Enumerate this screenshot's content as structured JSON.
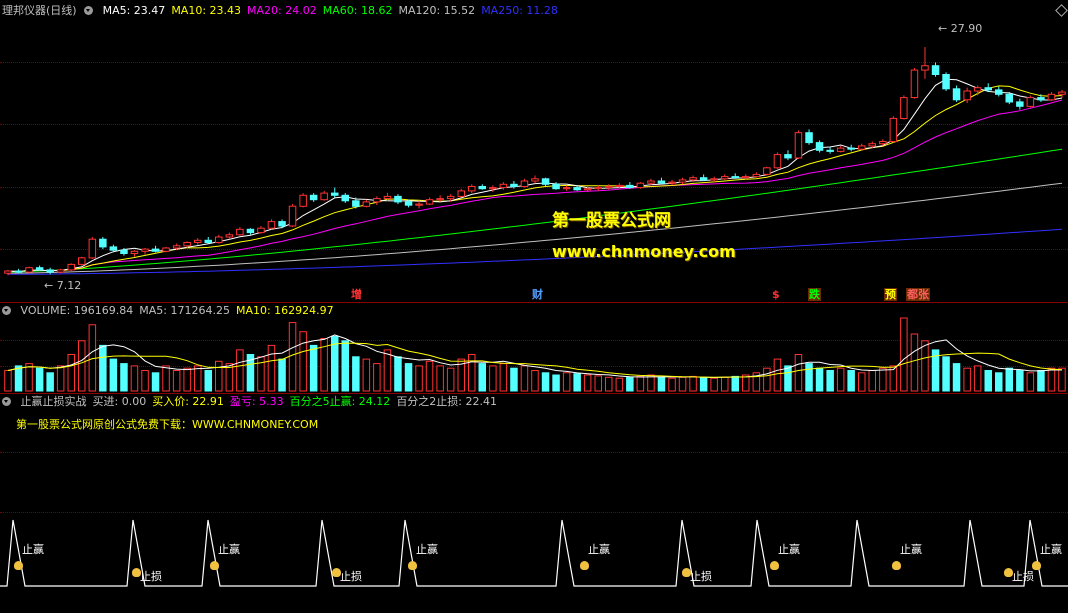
{
  "colors": {
    "up": "#ff3232",
    "down": "#54ffff",
    "ma5": "#ffffff",
    "ma10": "#ffff00",
    "ma20": "#ff00ff",
    "ma60": "#00ff00",
    "ma120": "#c0c0c0",
    "ma250": "#3030ff",
    "grid": "#7a0000"
  },
  "main_panel": {
    "title": "理邦仪器(日线)",
    "indicators": [
      {
        "label": "MA5: 23.47",
        "color": "#ffffff"
      },
      {
        "label": "MA10: 23.43",
        "color": "#ffff00"
      },
      {
        "label": "MA20: 24.02",
        "color": "#ff00ff"
      },
      {
        "label": "MA60: 18.62",
        "color": "#00ff00"
      },
      {
        "label": "MA120: 15.52",
        "color": "#c0c0c0"
      },
      {
        "label": "MA250: 11.28",
        "color": "#3030ff"
      }
    ],
    "high_label": "27.90",
    "low_label": "7.12",
    "event_tags": [
      {
        "text": "增",
        "color": "#ff3232",
        "bg": "#000000"
      },
      {
        "text": "财",
        "color": "#54a0ff",
        "bg": "#000000"
      },
      {
        "text": "$",
        "color": "#ff3232",
        "bg": "#000000"
      },
      {
        "text": "跌",
        "color": "#00ff00",
        "bg": "#6b2a00"
      },
      {
        "text": "预",
        "color": "#ffff00",
        "bg": "#6b2a00"
      },
      {
        "text": "都张",
        "color": "#ff6060",
        "bg": "#6b2a00"
      }
    ],
    "watermark_line1": "第一股票公式网",
    "watermark_line2": "www.chnmoney.com"
  },
  "volume_panel": {
    "indicators": [
      {
        "label": "VOLUME: 196169.84",
        "color": "#c0c0c0"
      },
      {
        "label": "MA5: 171264.25",
        "color": "#c0c0c0"
      },
      {
        "label": "MA10: 162924.97",
        "color": "#ffff00"
      }
    ]
  },
  "signal_panel": {
    "indicators": [
      {
        "label": "止赢止损实战",
        "color": "#c0c0c0"
      },
      {
        "label": "买进: 0.00",
        "color": "#c0c0c0"
      },
      {
        "label": "买入价: 22.91",
        "color": "#ffff00"
      },
      {
        "label": "盈亏: 5.33",
        "color": "#ff00ff"
      },
      {
        "label": "百分之5止赢: 24.12",
        "color": "#00ff00"
      },
      {
        "label": "百分之2止损: 22.41",
        "color": "#c0c0c0"
      }
    ],
    "promo": "第一股票公式网原创公式免费下载：WWW.CHNMONEY.COM",
    "take_profit_label": "止赢",
    "stop_loss_label": "止损"
  },
  "chart_data": {
    "type": "candlestick",
    "price_range": [
      7.12,
      27.9
    ],
    "price_axis_visible": [
      6.5,
      30.0
    ],
    "candles": [
      [
        7.3,
        7.6,
        7.1,
        7.5
      ],
      [
        7.5,
        7.7,
        7.3,
        7.4
      ],
      [
        7.4,
        7.9,
        7.3,
        7.8
      ],
      [
        7.8,
        8.0,
        7.5,
        7.6
      ],
      [
        7.6,
        7.8,
        7.2,
        7.4
      ],
      [
        7.4,
        7.7,
        7.3,
        7.6
      ],
      [
        7.6,
        8.2,
        7.5,
        8.1
      ],
      [
        8.1,
        8.8,
        8.0,
        8.7
      ],
      [
        8.7,
        10.6,
        8.6,
        10.4
      ],
      [
        10.4,
        10.6,
        9.5,
        9.7
      ],
      [
        9.7,
        9.9,
        9.2,
        9.4
      ],
      [
        9.4,
        9.6,
        8.9,
        9.1
      ],
      [
        9.1,
        9.4,
        8.8,
        9.3
      ],
      [
        9.3,
        9.6,
        9.0,
        9.5
      ],
      [
        9.5,
        9.8,
        9.2,
        9.3
      ],
      [
        9.3,
        9.7,
        9.2,
        9.6
      ],
      [
        9.6,
        10.0,
        9.4,
        9.8
      ],
      [
        9.8,
        10.2,
        9.6,
        10.1
      ],
      [
        10.1,
        10.5,
        9.9,
        10.3
      ],
      [
        10.3,
        10.6,
        10.0,
        10.1
      ],
      [
        10.1,
        10.8,
        10.0,
        10.6
      ],
      [
        10.6,
        11.0,
        10.4,
        10.8
      ],
      [
        10.8,
        11.5,
        10.7,
        11.3
      ],
      [
        11.3,
        11.4,
        10.8,
        11.0
      ],
      [
        11.0,
        11.6,
        10.9,
        11.4
      ],
      [
        11.4,
        12.2,
        11.3,
        12.0
      ],
      [
        12.0,
        12.2,
        11.4,
        11.6
      ],
      [
        11.6,
        13.6,
        11.5,
        13.4
      ],
      [
        13.4,
        14.6,
        13.3,
        14.4
      ],
      [
        14.4,
        14.6,
        13.8,
        14.0
      ],
      [
        14.0,
        14.8,
        13.9,
        14.6
      ],
      [
        14.6,
        15.1,
        14.2,
        14.4
      ],
      [
        14.4,
        14.6,
        13.7,
        13.9
      ],
      [
        13.9,
        14.2,
        13.2,
        13.4
      ],
      [
        13.4,
        14.0,
        13.3,
        13.8
      ],
      [
        13.8,
        14.3,
        13.5,
        14.1
      ],
      [
        14.1,
        14.6,
        13.9,
        14.3
      ],
      [
        14.3,
        14.5,
        13.6,
        13.8
      ],
      [
        13.8,
        14.0,
        13.3,
        13.5
      ],
      [
        13.5,
        13.9,
        13.2,
        13.6
      ],
      [
        13.6,
        14.2,
        13.5,
        14.0
      ],
      [
        14.0,
        14.4,
        13.8,
        14.1
      ],
      [
        14.1,
        14.5,
        13.8,
        14.3
      ],
      [
        14.3,
        15.0,
        14.2,
        14.8
      ],
      [
        14.8,
        15.4,
        14.6,
        15.2
      ],
      [
        15.2,
        15.4,
        14.9,
        15.0
      ],
      [
        15.0,
        15.3,
        14.7,
        15.1
      ],
      [
        15.1,
        15.6,
        14.9,
        15.4
      ],
      [
        15.4,
        15.7,
        15.0,
        15.2
      ],
      [
        15.2,
        15.9,
        15.1,
        15.7
      ],
      [
        15.7,
        16.2,
        15.5,
        15.9
      ],
      [
        15.9,
        16.0,
        15.2,
        15.4
      ],
      [
        15.4,
        15.6,
        14.9,
        15.0
      ],
      [
        15.0,
        15.3,
        14.8,
        15.1
      ],
      [
        15.1,
        15.3,
        14.8,
        14.9
      ],
      [
        14.9,
        15.2,
        14.7,
        15.0
      ],
      [
        15.0,
        15.3,
        14.8,
        15.1
      ],
      [
        15.1,
        15.4,
        14.9,
        15.2
      ],
      [
        15.2,
        15.5,
        15.0,
        15.3
      ],
      [
        15.3,
        15.6,
        15.0,
        15.1
      ],
      [
        15.1,
        15.6,
        15.0,
        15.5
      ],
      [
        15.5,
        15.9,
        15.3,
        15.7
      ],
      [
        15.7,
        16.0,
        15.4,
        15.5
      ],
      [
        15.5,
        15.8,
        15.3,
        15.6
      ],
      [
        15.6,
        16.0,
        15.4,
        15.8
      ],
      [
        15.8,
        16.2,
        15.6,
        16.0
      ],
      [
        16.0,
        16.3,
        15.7,
        15.8
      ],
      [
        15.8,
        16.1,
        15.6,
        15.9
      ],
      [
        15.9,
        16.3,
        15.8,
        16.1
      ],
      [
        16.1,
        16.4,
        15.9,
        16.0
      ],
      [
        16.0,
        16.3,
        15.8,
        16.1
      ],
      [
        16.1,
        16.5,
        16.0,
        16.3
      ],
      [
        16.3,
        17.0,
        16.2,
        16.9
      ],
      [
        16.9,
        18.3,
        16.8,
        18.1
      ],
      [
        18.1,
        18.5,
        17.6,
        17.8
      ],
      [
        17.8,
        20.3,
        17.7,
        20.1
      ],
      [
        20.1,
        20.4,
        19.0,
        19.2
      ],
      [
        19.2,
        19.4,
        18.3,
        18.5
      ],
      [
        18.5,
        18.8,
        18.2,
        18.4
      ],
      [
        18.4,
        18.9,
        18.3,
        18.7
      ],
      [
        18.7,
        19.0,
        18.4,
        18.6
      ],
      [
        18.6,
        19.1,
        18.5,
        18.9
      ],
      [
        18.9,
        19.3,
        18.7,
        19.1
      ],
      [
        19.1,
        19.5,
        18.9,
        19.3
      ],
      [
        19.3,
        21.6,
        19.2,
        21.4
      ],
      [
        21.4,
        23.5,
        21.3,
        23.3
      ],
      [
        23.3,
        26.0,
        23.2,
        25.8
      ],
      [
        25.8,
        27.9,
        25.0,
        26.2
      ],
      [
        26.2,
        26.5,
        25.2,
        25.4
      ],
      [
        25.4,
        25.6,
        23.9,
        24.1
      ],
      [
        24.1,
        24.4,
        22.9,
        23.1
      ],
      [
        23.1,
        24.2,
        22.8,
        23.9
      ],
      [
        23.9,
        24.4,
        23.5,
        24.2
      ],
      [
        24.2,
        24.6,
        23.8,
        24.0
      ],
      [
        24.0,
        24.3,
        23.4,
        23.6
      ],
      [
        23.6,
        23.8,
        22.7,
        22.9
      ],
      [
        22.9,
        23.2,
        22.2,
        22.5
      ],
      [
        22.5,
        23.5,
        22.4,
        23.3
      ],
      [
        23.3,
        23.6,
        22.9,
        23.1
      ],
      [
        23.1,
        23.8,
        23.0,
        23.6
      ],
      [
        23.6,
        24.0,
        23.3,
        23.8
      ]
    ],
    "volume": [
      0.45,
      0.55,
      0.6,
      0.5,
      0.4,
      0.55,
      0.8,
      1.1,
      1.45,
      1.0,
      0.7,
      0.6,
      0.55,
      0.45,
      0.4,
      0.55,
      0.45,
      0.5,
      0.55,
      0.45,
      0.65,
      0.6,
      0.9,
      0.8,
      0.75,
      1.0,
      0.7,
      1.5,
      1.3,
      1.0,
      1.15,
      1.2,
      1.1,
      0.75,
      0.7,
      0.6,
      0.9,
      0.75,
      0.6,
      0.55,
      0.65,
      0.55,
      0.5,
      0.7,
      0.8,
      0.6,
      0.55,
      0.6,
      0.5,
      0.55,
      0.45,
      0.4,
      0.35,
      0.4,
      0.38,
      0.35,
      0.33,
      0.3,
      0.28,
      0.3,
      0.32,
      0.35,
      0.3,
      0.28,
      0.3,
      0.32,
      0.3,
      0.28,
      0.3,
      0.32,
      0.35,
      0.4,
      0.5,
      0.7,
      0.55,
      0.8,
      0.6,
      0.5,
      0.45,
      0.5,
      0.45,
      0.4,
      0.45,
      0.5,
      0.55,
      1.6,
      1.25,
      1.1,
      0.9,
      0.75,
      0.6,
      0.5,
      0.55,
      0.45,
      0.4,
      0.5,
      0.45,
      0.4,
      0.45,
      0.5,
      0.5
    ],
    "volume_max": 1.6
  }
}
